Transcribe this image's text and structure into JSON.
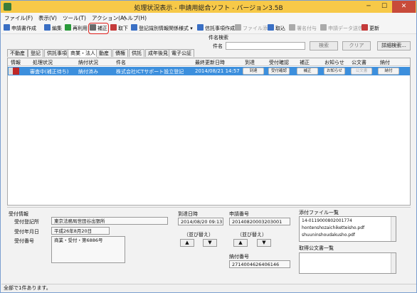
{
  "window": {
    "title": "処理状況表示 - 申請用総合ソフト - バージョン3.5B",
    "min_glyph": "─",
    "max_glyph": "☐",
    "close_glyph": "✕"
  },
  "menu": [
    "ファイル(F)",
    "表示(V)",
    "ツール(T)",
    "アクション(A)",
    "ヘルプ(H)"
  ],
  "toolbar": [
    {
      "label": "申請書作成",
      "icon": "create-document-icon",
      "color": "#3a6fc4"
    },
    {
      "label": "編集",
      "icon": "edit-icon",
      "color": "#3a6fc4"
    },
    {
      "label": "再利用",
      "icon": "reuse-icon",
      "color": "#2a9a3a"
    },
    {
      "label": "補正",
      "icon": "amend-icon",
      "color": "#6a6a6a"
    },
    {
      "label": "取下",
      "icon": "withdraw-icon",
      "color": "#c43a3a"
    },
    {
      "label": "登記識別情報関係様式 ▾",
      "icon": "form-icon",
      "color": "#3a6fc4"
    },
    {
      "label": "信託事項作成",
      "icon": "trust-icon",
      "color": "#3a6fc4"
    },
    {
      "label": "ファイル添付",
      "icon": "attach-icon",
      "color": "#aaaaaa"
    },
    {
      "label": "取込",
      "icon": "import-icon",
      "color": "#3a6fc4"
    },
    {
      "label": "署名付与",
      "icon": "sign-icon",
      "color": "#aaaaaa"
    },
    {
      "label": "申請データ送信",
      "icon": "send-icon",
      "color": "#aaaaaa"
    },
    {
      "label": "更新",
      "icon": "refresh-icon",
      "color": "#c43a3a"
    }
  ],
  "search": {
    "section_label": "件名検索",
    "field_label": "件名",
    "value": "",
    "search_button": "検索",
    "clear_button": "クリア",
    "advanced_button": "詳細検索..."
  },
  "tabs": [
    "不動産",
    "登記",
    "供託事項",
    "商業・法人",
    "動産",
    "債権",
    "供託",
    "成年後見",
    "電子公証"
  ],
  "grid": {
    "headers": [
      "情報",
      "処理状況",
      "納付状況",
      "件名",
      "最終更新日時",
      "到達",
      "受付確認",
      "補正",
      "お知らせ",
      "公文書",
      "納付"
    ],
    "row": {
      "status": "審査中(補正待ち)",
      "payment": "納付済み",
      "subject": "株式会社ICTサポート設立登記",
      "updated": "2014/08/21 14:57",
      "buttons": [
        "到達",
        "受付確認",
        "補正",
        "お知らせ",
        "公文書",
        "納付"
      ]
    }
  },
  "details": {
    "reception_title": "受付情報",
    "office_label": "受付登記所",
    "office_value": "東京法務局世田谷出張所",
    "date_label": "受付年月日",
    "date_value": "平成26年8月20日",
    "number_label": "受付番号",
    "number_value": "商業・受付・第6886号",
    "arrival_title": "到達日時",
    "arrival_value": "2014/08/20 09:13",
    "sort_label": "（並び替え）",
    "up_arrow": "▲",
    "down_arrow": "▼",
    "appno_title": "申請番号",
    "appno_value": "20140820003203001",
    "payno_title": "納付番号",
    "payno_value": "2714004626406146",
    "attach_title": "添付ファイル一覧",
    "attachments": [
      "14-0119000802001774",
      "hontenshozaichiketteisho.pdf",
      "shuuninshoudakusho.pdf"
    ],
    "official_title": "取得公文書一覧"
  },
  "status": "全部で1件あります。"
}
